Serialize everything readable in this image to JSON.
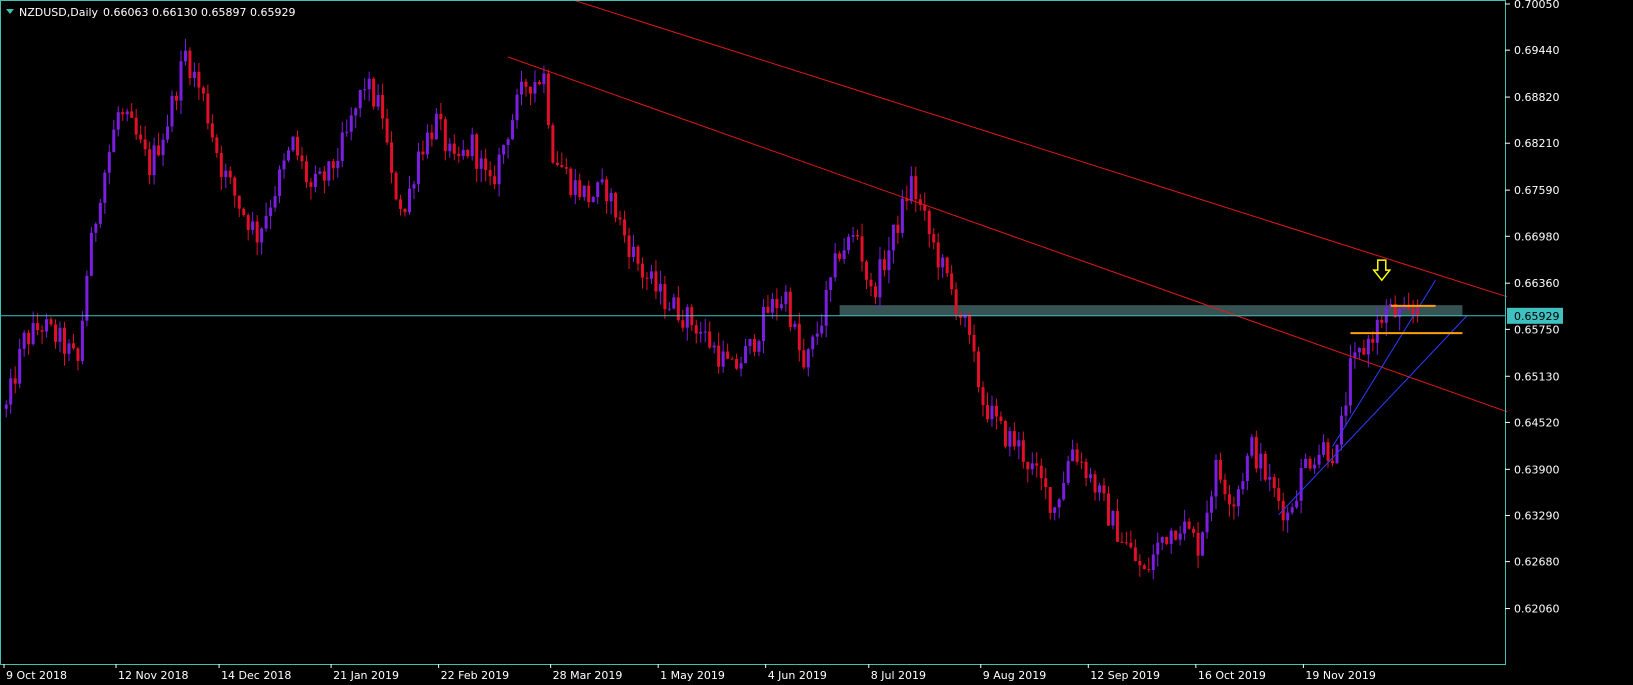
{
  "header": {
    "symbol": "NZDUSD,Daily",
    "ohlc": "0.66063 0.66130 0.65897 0.65929"
  },
  "colors": {
    "background": "#000000",
    "axis": "#40c0b0",
    "bull_candle": "#7a1fe0",
    "bear_candle": "#e0102a",
    "trendline_red": "#e01818",
    "trendline_blue": "#2a3cff",
    "support_zone": "#3d5b5b",
    "level_orange": "#ffa000",
    "arrow": "#ffff00",
    "price_line": "#40c0c0"
  },
  "chart_data": {
    "type": "candlestick",
    "title": "NZDUSD,Daily",
    "ohlc_last": {
      "open": 0.66063,
      "high": 0.6613,
      "low": 0.65897,
      "close": 0.65929
    },
    "current_price_label": "0.65929",
    "current_price": 0.65929,
    "y_range": [
      0.6175,
      0.7005
    ],
    "y_ticks": [
      "0.70050",
      "0.69440",
      "0.68820",
      "0.68210",
      "0.67590",
      "0.66980",
      "0.66360",
      "0.65750",
      "0.65130",
      "0.64520",
      "0.63900",
      "0.63290",
      "0.62680",
      "0.62060"
    ],
    "x_tick_labels": [
      "9 Oct 2018",
      "12 Nov 2018",
      "14 Dec 2018",
      "21 Jan 2019",
      "22 Feb 2019",
      "28 Mar 2019",
      "1 May 2019",
      "4 Jun 2019",
      "8 Jul 2019",
      "9 Aug 2019",
      "12 Sep 2019",
      "16 Oct 2019",
      "19 Nov 2019"
    ],
    "x_tick_bars": [
      0,
      25,
      48,
      73,
      97,
      122,
      146,
      170,
      193,
      218,
      242,
      266,
      290
    ],
    "bars_total": 335,
    "price_path": [
      [
        0,
        0.647
      ],
      [
        4,
        0.656
      ],
      [
        8,
        0.658
      ],
      [
        12,
        0.656
      ],
      [
        16,
        0.653
      ],
      [
        18,
        0.665
      ],
      [
        21,
        0.676
      ],
      [
        25,
        0.686
      ],
      [
        28,
        0.684
      ],
      [
        32,
        0.679
      ],
      [
        36,
        0.685
      ],
      [
        40,
        0.694
      ],
      [
        44,
        0.688
      ],
      [
        48,
        0.679
      ],
      [
        52,
        0.674
      ],
      [
        56,
        0.67
      ],
      [
        60,
        0.676
      ],
      [
        64,
        0.682
      ],
      [
        68,
        0.676
      ],
      [
        72,
        0.678
      ],
      [
        76,
        0.683
      ],
      [
        80,
        0.69
      ],
      [
        84,
        0.686
      ],
      [
        86,
        0.677
      ],
      [
        89,
        0.673
      ],
      [
        92,
        0.681
      ],
      [
        96,
        0.685
      ],
      [
        100,
        0.679
      ],
      [
        104,
        0.682
      ],
      [
        108,
        0.676
      ],
      [
        112,
        0.684
      ],
      [
        116,
        0.69
      ],
      [
        120,
        0.691
      ],
      [
        122,
        0.681
      ],
      [
        126,
        0.677
      ],
      [
        130,
        0.675
      ],
      [
        134,
        0.676
      ],
      [
        138,
        0.67
      ],
      [
        142,
        0.665
      ],
      [
        146,
        0.662
      ],
      [
        150,
        0.66
      ],
      [
        154,
        0.658
      ],
      [
        158,
        0.655
      ],
      [
        162,
        0.652
      ],
      [
        166,
        0.655
      ],
      [
        170,
        0.66
      ],
      [
        174,
        0.662
      ],
      [
        178,
        0.652
      ],
      [
        182,
        0.659
      ],
      [
        186,
        0.668
      ],
      [
        190,
        0.67
      ],
      [
        193,
        0.662
      ],
      [
        197,
        0.668
      ],
      [
        202,
        0.677
      ],
      [
        206,
        0.67
      ],
      [
        210,
        0.664
      ],
      [
        214,
        0.658
      ],
      [
        218,
        0.648
      ],
      [
        222,
        0.644
      ],
      [
        226,
        0.642
      ],
      [
        230,
        0.638
      ],
      [
        234,
        0.634
      ],
      [
        238,
        0.642
      ],
      [
        242,
        0.638
      ],
      [
        246,
        0.633
      ],
      [
        250,
        0.629
      ],
      [
        254,
        0.625
      ],
      [
        258,
        0.63
      ],
      [
        262,
        0.632
      ],
      [
        266,
        0.629
      ],
      [
        270,
        0.639
      ],
      [
        274,
        0.635
      ],
      [
        278,
        0.642
      ],
      [
        282,
        0.637
      ],
      [
        286,
        0.633
      ],
      [
        290,
        0.64
      ],
      [
        294,
        0.642
      ],
      [
        297,
        0.641
      ],
      [
        300,
        0.652
      ],
      [
        304,
        0.656
      ],
      [
        308,
        0.66
      ],
      [
        312,
        0.659
      ],
      [
        315,
        0.65929
      ]
    ],
    "trendlines_red": [
      {
        "from": [
          124,
          0.7015
        ],
        "to": [
          335,
          0.6618
        ]
      },
      {
        "from": [
          112,
          0.6935
        ],
        "to": [
          335,
          0.6466
        ]
      }
    ],
    "trendlines_blue": [
      {
        "from": [
          296,
          0.642
        ],
        "to": [
          319,
          0.664
        ]
      },
      {
        "from": [
          284,
          0.633
        ],
        "to": [
          326,
          0.6593
        ]
      }
    ],
    "support_zone": {
      "x_from": 186,
      "x_to": 325,
      "y_low": 0.6593,
      "y_high": 0.6607
    },
    "orange_levels": [
      {
        "x_from": 300,
        "x_to": 325,
        "y": 0.657
      },
      {
        "x_from": 309,
        "x_to": 319,
        "y": 0.6606
      }
    ],
    "marker_arrow": {
      "bar": 307,
      "y": 0.664,
      "direction": "down"
    }
  }
}
